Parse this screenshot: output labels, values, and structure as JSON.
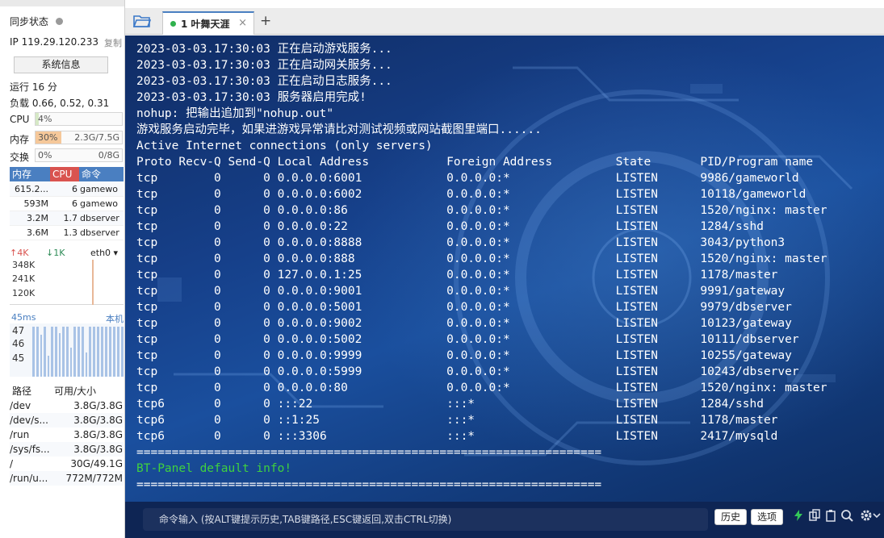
{
  "sidebar": {
    "sync_label": "同步状态",
    "ip_label": "IP",
    "ip_value": "119.29.120.233",
    "copy_label": "复制",
    "sysinfo_button": "系统信息",
    "uptime": "运行 16 分",
    "load": "负载 0.66, 0.52, 0.31",
    "cpu": {
      "label": "CPU",
      "percent_text": "4%",
      "fill": 0.04,
      "color": "#d6e9c6"
    },
    "mem": {
      "label": "内存",
      "percent_text": "30%",
      "amount": "2.3G/7.5G",
      "fill": 0.3,
      "color": "#f5c89a"
    },
    "swap": {
      "label": "交换",
      "percent_text": "0%",
      "amount": "0/8G",
      "fill": 0.0,
      "color": "#d6e9c6"
    },
    "proc_headers": {
      "mem": "内存",
      "cpu": "CPU",
      "cmd": "命令"
    },
    "processes": [
      {
        "mem": "615.2...",
        "cpu": "6",
        "cmd": "gamewo"
      },
      {
        "mem": "593M",
        "cpu": "6",
        "cmd": "gamewo"
      },
      {
        "mem": "3.2M",
        "cpu": "1.7",
        "cmd": "dbserver"
      },
      {
        "mem": "3.6M",
        "cpu": "1.3",
        "cmd": "dbserver"
      }
    ],
    "net": {
      "up": "↑4K",
      "down": "↓1K",
      "iface": "eth0 ▾",
      "ticks": [
        "348K",
        "241K",
        "120K"
      ]
    },
    "latency": {
      "ms": "45ms",
      "location": "本机",
      "ticks": [
        "47",
        "46",
        "45"
      ]
    },
    "disk_headers": {
      "path": "路径",
      "size": "可用/大小"
    },
    "disks": [
      {
        "path": "/dev",
        "size": "3.8G/3.8G"
      },
      {
        "path": "/dev/s...",
        "size": "3.8G/3.8G"
      },
      {
        "path": "/run",
        "size": "3.8G/3.8G"
      },
      {
        "path": "/sys/fs...",
        "size": "3.8G/3.8G"
      },
      {
        "path": "/",
        "size": "30G/49.1G"
      },
      {
        "path": "/run/u...",
        "size": "772M/772M"
      }
    ]
  },
  "tabs": [
    {
      "label": "1 叶舞天涯",
      "close": "×"
    }
  ],
  "new_tab": "+",
  "terminal": {
    "lines": [
      "2023-03-03.17:30:03 正在启动游戏服务...",
      "2023-03-03.17:30:03 正在启动网关服务...",
      "2023-03-03.17:30:03 正在启动日志服务...",
      "2023-03-03.17:30:03 服务器启用完成!",
      "nohup: 把输出追加到\"nohup.out\"",
      "游戏服务启动完毕，如果进游戏异常请比对测试视频或网站截图里端口......",
      "Active Internet connections (only servers)",
      "Proto Recv-Q Send-Q Local Address           Foreign Address         State       PID/Program name",
      "tcp        0      0 0.0.0.0:6001            0.0.0.0:*               LISTEN      9986/gameworld",
      "tcp        0      0 0.0.0.0:6002            0.0.0.0:*               LISTEN      10118/gameworld",
      "tcp        0      0 0.0.0.0:86              0.0.0.0:*               LISTEN      1520/nginx: master",
      "tcp        0      0 0.0.0.0:22              0.0.0.0:*               LISTEN      1284/sshd",
      "tcp        0      0 0.0.0.0:8888            0.0.0.0:*               LISTEN      3043/python3",
      "tcp        0      0 0.0.0.0:888             0.0.0.0:*               LISTEN      1520/nginx: master",
      "tcp        0      0 127.0.0.1:25            0.0.0.0:*               LISTEN      1178/master",
      "tcp        0      0 0.0.0.0:9001            0.0.0.0:*               LISTEN      9991/gateway",
      "tcp        0      0 0.0.0.0:5001            0.0.0.0:*               LISTEN      9979/dbserver",
      "tcp        0      0 0.0.0.0:9002            0.0.0.0:*               LISTEN      10123/gateway",
      "tcp        0      0 0.0.0.0:5002            0.0.0.0:*               LISTEN      10111/dbserver",
      "tcp        0      0 0.0.0.0:9999            0.0.0.0:*               LISTEN      10255/gateway",
      "tcp        0      0 0.0.0.0:5999            0.0.0.0:*               LISTEN      10243/dbserver",
      "tcp        0      0 0.0.0.0:80              0.0.0.0:*               LISTEN      1520/nginx: master",
      "tcp6       0      0 :::22                   :::*                    LISTEN      1284/sshd",
      "tcp6       0      0 ::1:25                  :::*                    LISTEN      1178/master",
      "tcp6       0      0 :::3306                 :::*                    LISTEN      2417/mysqld"
    ],
    "rule": "==================================================================",
    "panel_info": "BT-Panel default info!"
  },
  "cmdbar": {
    "placeholder": "命令输入 (按ALT键提示历史,TAB键路径,ESC键返回,双击CTRL切换)",
    "history_button": "历史",
    "options_button": "选项",
    "icons": [
      "lightning-icon",
      "copy-icon",
      "clipboard-icon",
      "search-icon",
      "gear-icon",
      "chevron-down-icon"
    ]
  }
}
